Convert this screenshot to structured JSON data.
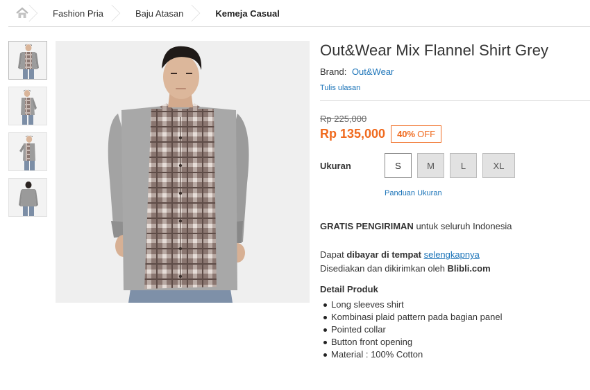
{
  "breadcrumb": {
    "items": [
      "Fashion Pria",
      "Baju Atasan",
      "Kemeja Casual"
    ]
  },
  "product": {
    "title": "Out&Wear Mix Flannel Shirt Grey",
    "brand_label": "Brand:",
    "brand_name": "Out&Wear",
    "review_link": "Tulis ulasan",
    "old_price": "Rp 225,000",
    "price": "Rp 135,000",
    "discount_pct": "40%",
    "discount_label": "OFF",
    "size_label": "Ukuran",
    "sizes": [
      "S",
      "M",
      "L",
      "XL"
    ],
    "selected_size": "S",
    "size_guide": "Panduan Ukuran",
    "shipping_bold": "GRATIS PENGIRIMAN",
    "shipping_rest": " untuk seluruh Indonesia",
    "cod_pre": "Dapat ",
    "cod_bold": "dibayar di tempat",
    "cod_link": "selengkapnya",
    "seller_pre": "Disediakan dan dikirimkan oleh ",
    "seller_bold": "Blibli.com",
    "detail_title": "Detail Produk",
    "details": [
      "Long sleeves shirt",
      "Kombinasi plaid pattern pada bagian panel",
      "Pointed collar",
      "Button front opening",
      "Material : 100% Cotton"
    ]
  },
  "colors": {
    "accent_orange": "#f06a1e",
    "link_blue": "#1a73b8",
    "shirt_grey": "#9a9a9a",
    "plaid_brown": "#7a6660"
  },
  "icons": {
    "home": "home-icon"
  }
}
